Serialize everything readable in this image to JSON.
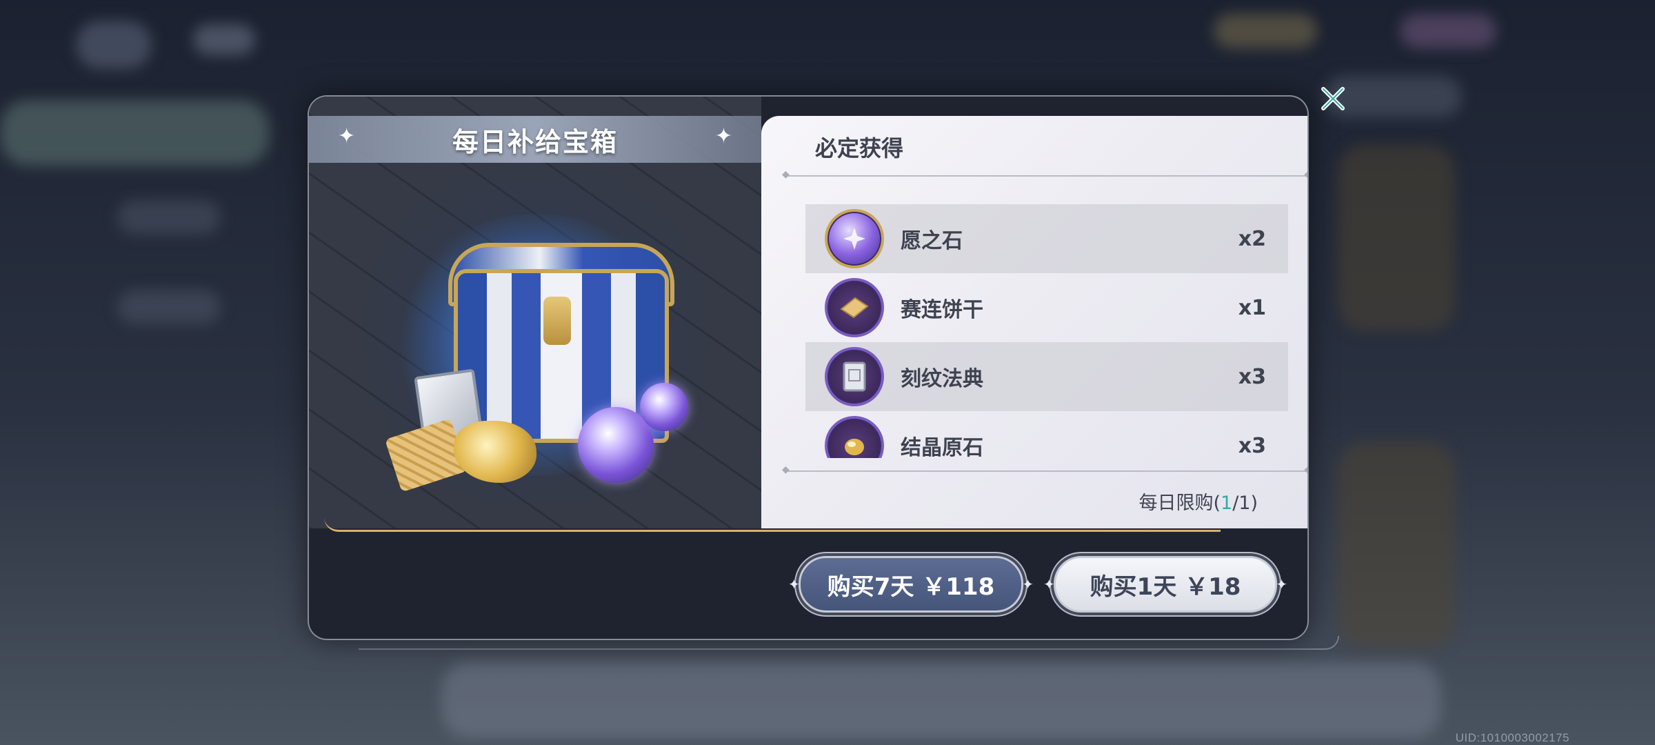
{
  "modal": {
    "title": "每日补给宝箱",
    "rewards_header": "必定获得",
    "rewards": [
      {
        "name": "愿之石",
        "qty": "x2",
        "icon": "wish-stone-icon"
      },
      {
        "name": "赛连饼干",
        "qty": "x1",
        "icon": "cookie-icon"
      },
      {
        "name": "刻纹法典",
        "qty": "x3",
        "icon": "codex-icon"
      },
      {
        "name": "结晶原石",
        "qty": "x3",
        "icon": "crystal-ore-icon"
      }
    ],
    "limit_prefix": "每日限购(",
    "limit_used": "1",
    "limit_suffix": "/1)",
    "buy7_label": "购买7天 ￥118",
    "buy1_label": "购买1天 ￥18",
    "close_icon": "close-icon"
  },
  "footer": {
    "uid": "UID:1010003002175"
  },
  "colors": {
    "accent_teal": "#3aa9a0",
    "button_primary": "#4d5c82",
    "gold_line": "#d9b26b"
  }
}
